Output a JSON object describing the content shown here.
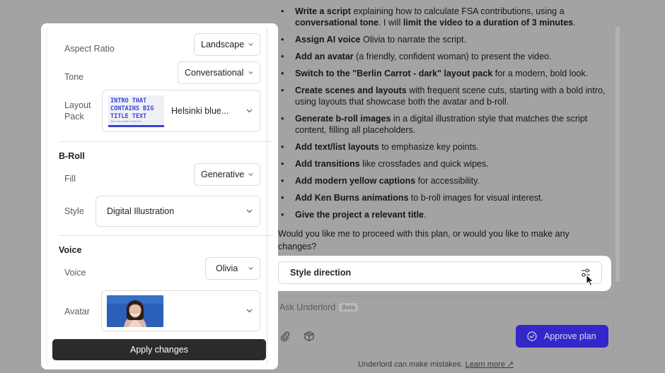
{
  "panel": {
    "aspect_ratio": {
      "label": "Aspect Ratio",
      "value": "Landscape"
    },
    "tone": {
      "label": "Tone",
      "value": "Conversational"
    },
    "layout_pack": {
      "label": "Layout Pack",
      "value": "Helsinki blue...",
      "thumb_title": "INTRO THAT CONTAINS BIG TITLE TEXT",
      "thumb_subtitle": "this is the subtitle of the intro"
    },
    "broll": {
      "heading": "B-Roll",
      "fill": {
        "label": "Fill",
        "value": "Generative"
      },
      "style": {
        "label": "Style",
        "value": "Digital Illustration"
      }
    },
    "voice_section": {
      "heading": "Voice",
      "voice": {
        "label": "Voice",
        "value": "Olivia"
      },
      "avatar": {
        "label": "Avatar"
      }
    },
    "apply_label": "Apply changes"
  },
  "plan": {
    "items": [
      {
        "bold": "Write a script",
        "rest": " explaining how to calculate FSA contributions, using a ",
        "bold2": "conversational tone",
        "rest2": ". I will ",
        "bold3": "limit the video to a duration of 3 minutes",
        "rest3": "."
      },
      {
        "bold": "Assign AI voice",
        "rest": " Olivia to narrate the script."
      },
      {
        "bold": "Add an avatar",
        "rest": " (a friendly, confident woman) to present the video."
      },
      {
        "bold": "Switch to the \"Berlin Carrot - dark\" layout pack",
        "rest": " for a modern, bold look."
      },
      {
        "bold": "Create scenes and layouts",
        "rest": " with frequent scene cuts, starting with a bold intro, using layouts that showcase both the avatar and b-roll."
      },
      {
        "bold": "Generate b-roll images",
        "rest": " in a digital illustration style that matches the script content, filling all placeholders."
      },
      {
        "bold": "Add text/list layouts",
        "rest": " to emphasize key points."
      },
      {
        "bold": "Add transitions",
        "rest": " like crossfades and quick wipes."
      },
      {
        "bold": "Add modern yellow captions",
        "rest": " for accessibility."
      },
      {
        "bold": "Add Ken Burns animations",
        "rest": " to b-roll images for visual interest."
      },
      {
        "bold": "Give the project a relevant title",
        "rest": "."
      }
    ],
    "question": "Would you like me to proceed with this plan, or would you like to make any changes?"
  },
  "style_direction": {
    "label": "Style direction"
  },
  "composer": {
    "placeholder": "Ask Underlord",
    "beta": "Beta",
    "approve_label": "Approve plan"
  },
  "footer": {
    "note": "Underlord can make mistakes.",
    "link": "Learn more ↗"
  },
  "colors": {
    "overlay": "#a3a3a3",
    "accent": "#3427c9",
    "apply_button": "#2b2b2b",
    "thumb_accent": "#3a42d6"
  }
}
